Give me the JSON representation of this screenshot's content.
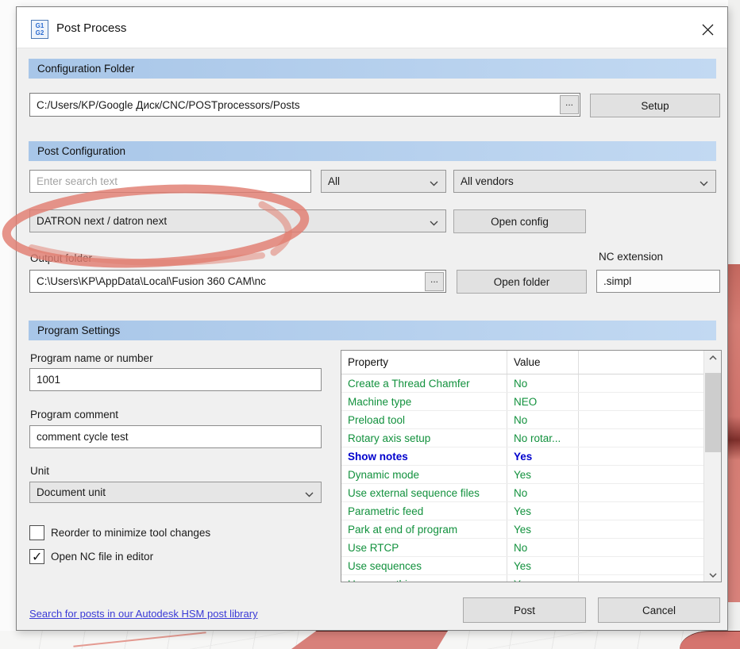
{
  "dialog": {
    "title": "Post Process",
    "icon_line1": "G1",
    "icon_line2": "G2"
  },
  "config_folder": {
    "header": "Configuration Folder",
    "path": "C:/Users/KP/Google Диск/CNC/POSTprocessors/Posts",
    "browse_label": "...",
    "setup_label": "Setup"
  },
  "post_config": {
    "header": "Post Configuration",
    "search_placeholder": "Enter search text",
    "filter_capability": "All",
    "filter_vendor": "All vendors",
    "selected_post": "DATRON next / datron next",
    "open_config_label": "Open config",
    "output_folder_label": "Output folder",
    "output_folder_path": "C:\\Users\\KP\\AppData\\Local\\Fusion 360 CAM\\nc",
    "browse_label": "...",
    "open_folder_label": "Open folder",
    "nc_extension_label": "NC extension",
    "nc_extension_value": ".simpl"
  },
  "program_settings": {
    "header": "Program Settings",
    "name_label": "Program name or number",
    "name_value": "1001",
    "comment_label": "Program comment",
    "comment_value": "comment cycle test",
    "unit_label": "Unit",
    "unit_value": "Document unit",
    "checkbox_reorder": {
      "label": "Reorder to minimize tool changes",
      "checked": false
    },
    "checkbox_open_nc": {
      "label": "Open NC file in editor",
      "checked": true
    }
  },
  "properties_table": {
    "columns": [
      "Property",
      "Value"
    ],
    "rows": [
      {
        "property": "Create a Thread Chamfer",
        "value": "No",
        "style": "green"
      },
      {
        "property": "Machine type",
        "value": "NEO",
        "style": "green"
      },
      {
        "property": "Preload tool",
        "value": "No",
        "style": "green"
      },
      {
        "property": "Rotary axis setup",
        "value": "No rotar...",
        "style": "green"
      },
      {
        "property": "Show notes",
        "value": "Yes",
        "style": "blue-bold"
      },
      {
        "property": "Dynamic mode",
        "value": "Yes",
        "style": "green"
      },
      {
        "property": "Use external sequence files",
        "value": "No",
        "style": "green"
      },
      {
        "property": "Parametric feed",
        "value": "Yes",
        "style": "green"
      },
      {
        "property": "Park at end of program",
        "value": "Yes",
        "style": "green"
      },
      {
        "property": "Use RTCP",
        "value": "No",
        "style": "green"
      },
      {
        "property": "Use sequences",
        "value": "Yes",
        "style": "green"
      },
      {
        "property": "Use smoothing",
        "value": "Yes",
        "style": "green"
      }
    ]
  },
  "footer": {
    "link_label": "Search for posts in our Autodesk HSM post library",
    "post_label": "Post",
    "cancel_label": "Cancel"
  },
  "colors": {
    "section_header_blue": "#a8c6e8",
    "section_header_blue_light": "#c2d9f2",
    "property_green": "#12913d",
    "highlight_blue": "#0000cd",
    "link_blue": "#3a3ad6",
    "marker_red": "#e07d70",
    "viewport_red": "#d8807a"
  }
}
